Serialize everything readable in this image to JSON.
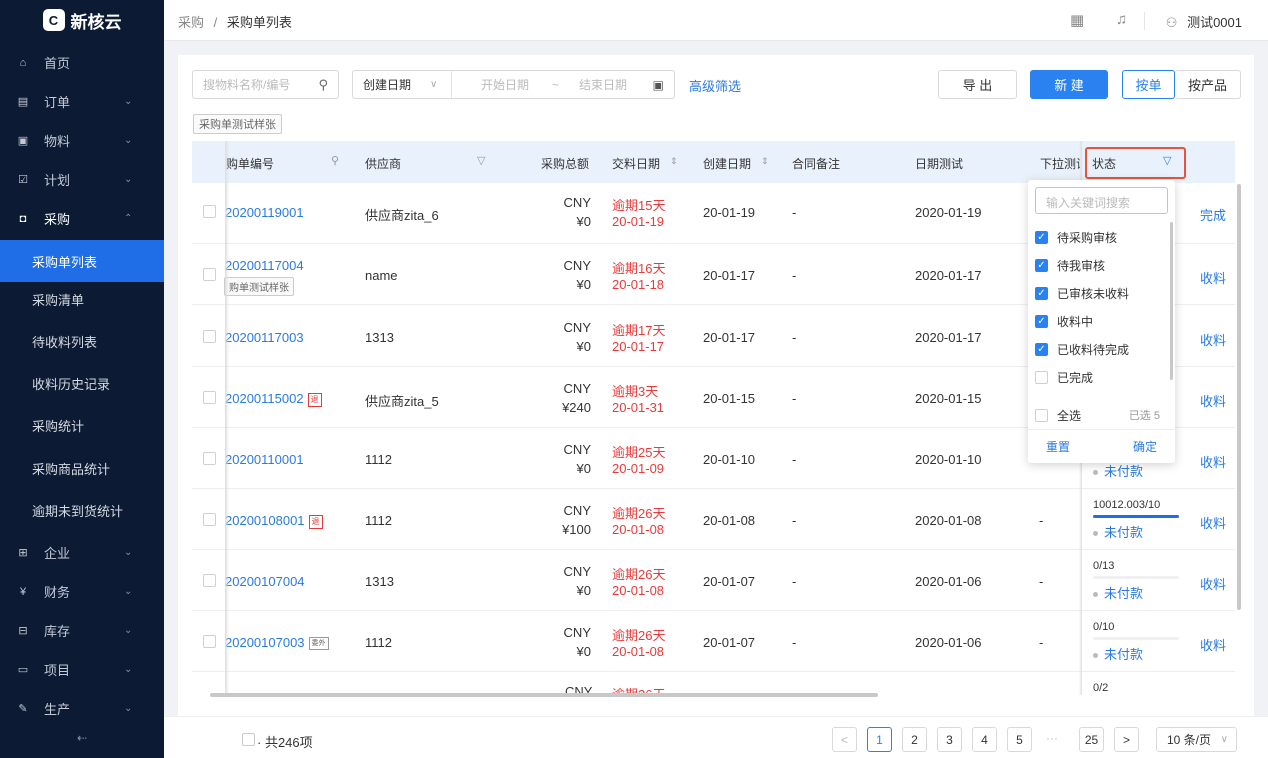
{
  "brand": {
    "name": "新核云",
    "mark": "C"
  },
  "nav": {
    "items": [
      {
        "label": "首页",
        "icon": "home-icon",
        "chev": ""
      },
      {
        "label": "订单",
        "icon": "order-icon",
        "chev": "⌄"
      },
      {
        "label": "物料",
        "icon": "material-icon",
        "chev": "⌄"
      },
      {
        "label": "计划",
        "icon": "calendar-icon",
        "chev": "⌄"
      },
      {
        "label": "采购",
        "icon": "bag-icon",
        "chev": "⌃"
      }
    ],
    "sub_items": [
      "采购单列表",
      "采购清单",
      "待收料列表",
      "收料历史记录",
      "采购统计",
      "采购商品统计",
      "逾期未到货统计"
    ],
    "items_bottom": [
      {
        "label": "企业",
        "icon": "enterprise-icon",
        "chev": "⌄"
      },
      {
        "label": "财务",
        "icon": "finance-icon",
        "chev": "⌄"
      },
      {
        "label": "库存",
        "icon": "inventory-icon",
        "chev": "⌄"
      },
      {
        "label": "项目",
        "icon": "folder-icon",
        "chev": "⌄"
      },
      {
        "label": "生产",
        "icon": "wrench-icon",
        "chev": "⌄"
      }
    ],
    "collapse": "⇠"
  },
  "breadcrumb": {
    "parent": "采购",
    "sep": "/",
    "current": "采购单列表"
  },
  "user": {
    "name": "测试0001"
  },
  "toolbar": {
    "search_placeholder": "搜物料名称/编号",
    "date_type": "创建日期",
    "start_placeholder": "开始日期",
    "tilde": "~",
    "end_placeholder": "结束日期",
    "advanced": "高级筛选",
    "export": "导 出",
    "create": "新 建",
    "seg_order": "按单",
    "seg_product": "按产品",
    "sample_tag": "采购单测试样张"
  },
  "columns": [
    "购单编号",
    "供应商",
    "采购总额",
    "交料日期",
    "创建日期",
    "合同备注",
    "日期测试",
    "下拉测试",
    "状态"
  ],
  "rows": [
    {
      "order": "20200119001",
      "badge": "",
      "tag": "",
      "supplier": "供应商zita_6",
      "currency": "CNY",
      "amount": "¥0",
      "overdue": "逾期15天",
      "due": "20-01-19",
      "created": "20-01-19",
      "remark": "-",
      "datetest": "2020-01-19",
      "dropdown": "",
      "progress": "",
      "pay": "",
      "action": "完成"
    },
    {
      "order": "20200117004",
      "badge": "",
      "tag": "购单测试样张",
      "supplier": "name",
      "currency": "CNY",
      "amount": "¥0",
      "overdue": "逾期16天",
      "due": "20-01-18",
      "created": "20-01-17",
      "remark": "-",
      "datetest": "2020-01-17",
      "dropdown": "",
      "progress": "",
      "pay": "",
      "action": "收料"
    },
    {
      "order": "20200117003",
      "badge": "",
      "tag": "",
      "supplier": "1313",
      "currency": "CNY",
      "amount": "¥0",
      "overdue": "逾期17天",
      "due": "20-01-17",
      "created": "20-01-17",
      "remark": "-",
      "datetest": "2020-01-17",
      "dropdown": "",
      "progress": "",
      "pay": "",
      "action": "收料"
    },
    {
      "order": "20200115002",
      "badge": "退",
      "tag": "",
      "supplier": "供应商zita_5",
      "currency": "CNY",
      "amount": "¥240",
      "overdue": "逾期3天",
      "due": "20-01-31",
      "created": "20-01-15",
      "remark": "-",
      "datetest": "2020-01-15",
      "dropdown": "",
      "progress": "",
      "pay": "",
      "action": "收料"
    },
    {
      "order": "20200110001",
      "badge": "",
      "tag": "",
      "supplier": "1112",
      "currency": "CNY",
      "amount": "¥0",
      "overdue": "逾期25天",
      "due": "20-01-09",
      "created": "20-01-10",
      "remark": "-",
      "datetest": "2020-01-10",
      "dropdown": "",
      "progress": "",
      "pay": "未付款",
      "action": "收料"
    },
    {
      "order": "20200108001",
      "badge": "退",
      "tag": "",
      "supplier": "1112",
      "currency": "CNY",
      "amount": "¥100",
      "overdue": "逾期26天",
      "due": "20-01-08",
      "created": "20-01-08",
      "remark": "-",
      "datetest": "2020-01-08",
      "dropdown": "-",
      "progress": "10012.003/10",
      "progress_fill": 1.0,
      "pay": "未付款",
      "action": "收料"
    },
    {
      "order": "20200107004",
      "badge": "",
      "tag": "",
      "supplier": "1313",
      "currency": "CNY",
      "amount": "¥0",
      "overdue": "逾期26天",
      "due": "20-01-08",
      "created": "20-01-07",
      "remark": "-",
      "datetest": "2020-01-06",
      "dropdown": "-",
      "progress": "0/13",
      "progress_fill": 0,
      "pay": "未付款",
      "action": "收料"
    },
    {
      "order": "20200107003",
      "badge": "委外",
      "tag": "",
      "supplier": "1112",
      "currency": "CNY",
      "amount": "¥0",
      "overdue": "逾期26天",
      "due": "20-01-08",
      "created": "20-01-07",
      "remark": "-",
      "datetest": "2020-01-06",
      "dropdown": "-",
      "progress": "0/10",
      "progress_fill": 0,
      "pay": "未付款",
      "action": "收料"
    }
  ],
  "partial_row": {
    "currency": "CNY",
    "overdue": "逾期26天",
    "progress": "0/2"
  },
  "status_filter": {
    "search_placeholder": "输入关键词搜索",
    "options": [
      {
        "label": "待采购审核",
        "checked": true
      },
      {
        "label": "待我审核",
        "checked": true
      },
      {
        "label": "已审核未收料",
        "checked": true
      },
      {
        "label": "收料中",
        "checked": true
      },
      {
        "label": "已收料待完成",
        "checked": true
      },
      {
        "label": "已完成",
        "checked": false
      }
    ],
    "select_all": "全选",
    "selected_count": "已选 5",
    "reset": "重置",
    "confirm": "确定"
  },
  "footer": {
    "total": "· 共246项",
    "pages": [
      "1",
      "2",
      "3",
      "4",
      "5",
      "25"
    ],
    "ellipsis": "···",
    "prev": "<",
    "next": ">",
    "page_size": "10 条/页"
  },
  "colors": {
    "primary": "#2a82f0",
    "sidebar": "#0c1a33",
    "danger": "#e83a3a",
    "highlight": "#e5553c"
  }
}
